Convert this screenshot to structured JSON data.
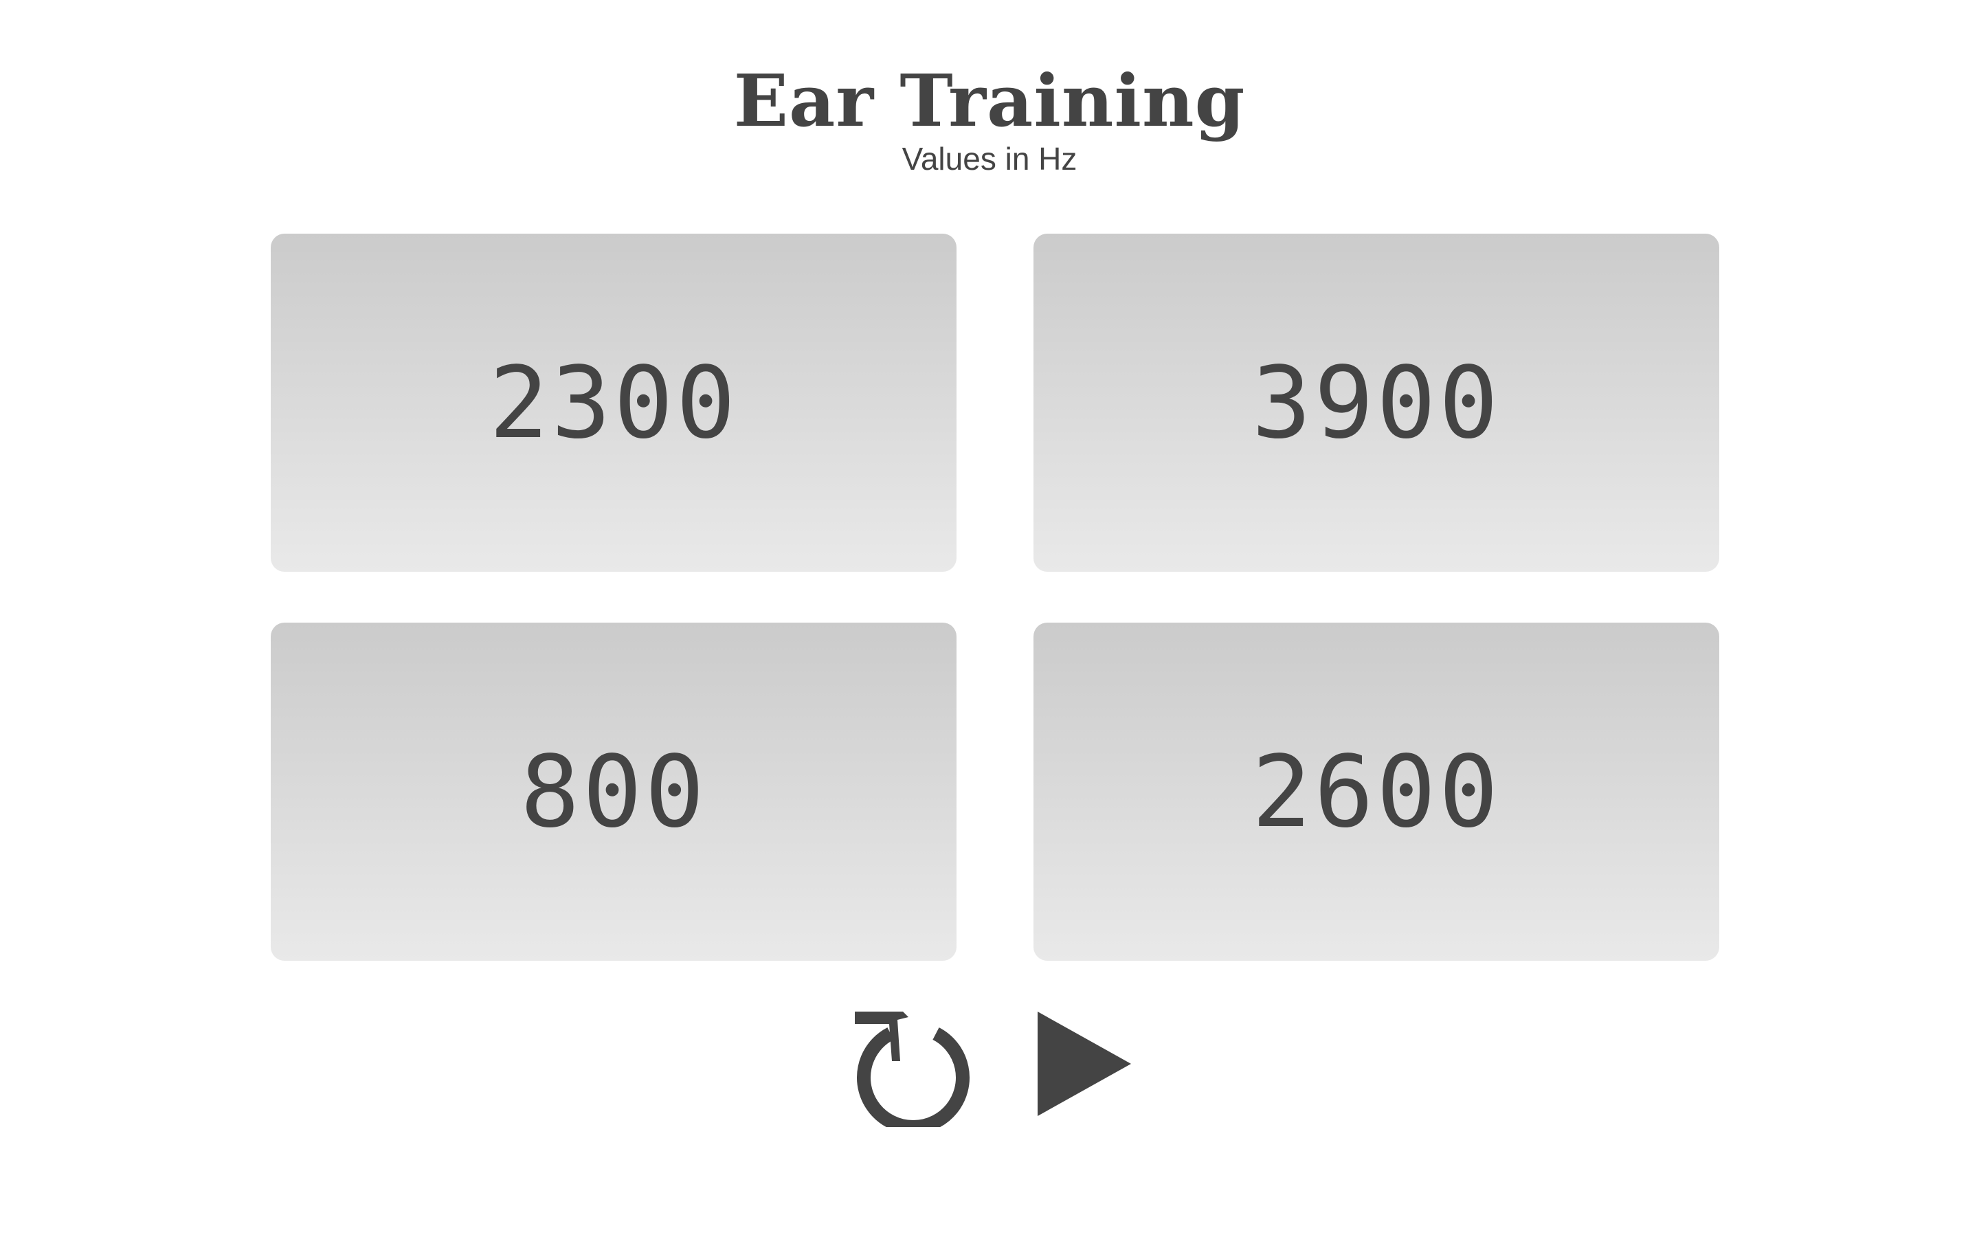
{
  "header": {
    "title": "Ear Training",
    "subtitle": "Values in Hz"
  },
  "choices": [
    {
      "label": "2300"
    },
    {
      "label": "3900"
    },
    {
      "label": "800"
    },
    {
      "label": "2600"
    }
  ],
  "controls": {
    "replay_icon": "replay-icon",
    "play_icon": "play-icon"
  },
  "colors": {
    "text": "#444444",
    "button_gradient_top": "#cbcbcb",
    "button_gradient_bottom": "#e9e9e9",
    "background": "#ffffff"
  }
}
